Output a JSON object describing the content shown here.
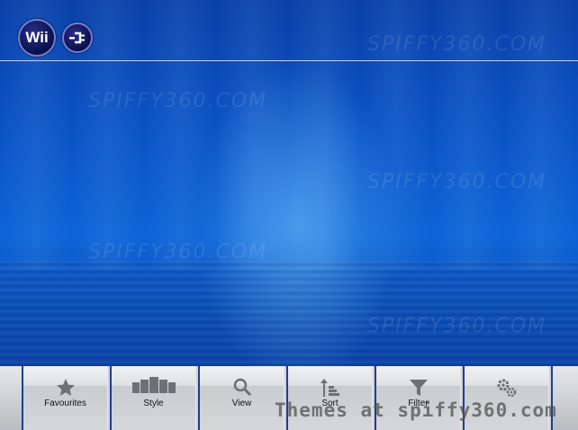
{
  "header": {
    "logo_text": "Wii",
    "logo_icon": "wii-logo",
    "connection_icon": "plug-icon"
  },
  "watermark_text": "SPIFFY360.COM",
  "toolbar": {
    "buttons": [
      {
        "label": "Favourites",
        "icon": "star-icon"
      },
      {
        "label": "Style",
        "icon": "style-icon"
      },
      {
        "label": "View",
        "icon": "magnifier-icon"
      },
      {
        "label": "Sort",
        "icon": "sort-icon"
      },
      {
        "label": "Filter",
        "icon": "filter-icon"
      },
      {
        "label": "",
        "icon": "gears-icon"
      }
    ]
  },
  "footer_credit": "Themes at spiffy360.com",
  "colors": {
    "background_blue": "#0b56c9",
    "toolbar_gray": "#cfd2d6",
    "button_border": "#1f3f8f"
  }
}
